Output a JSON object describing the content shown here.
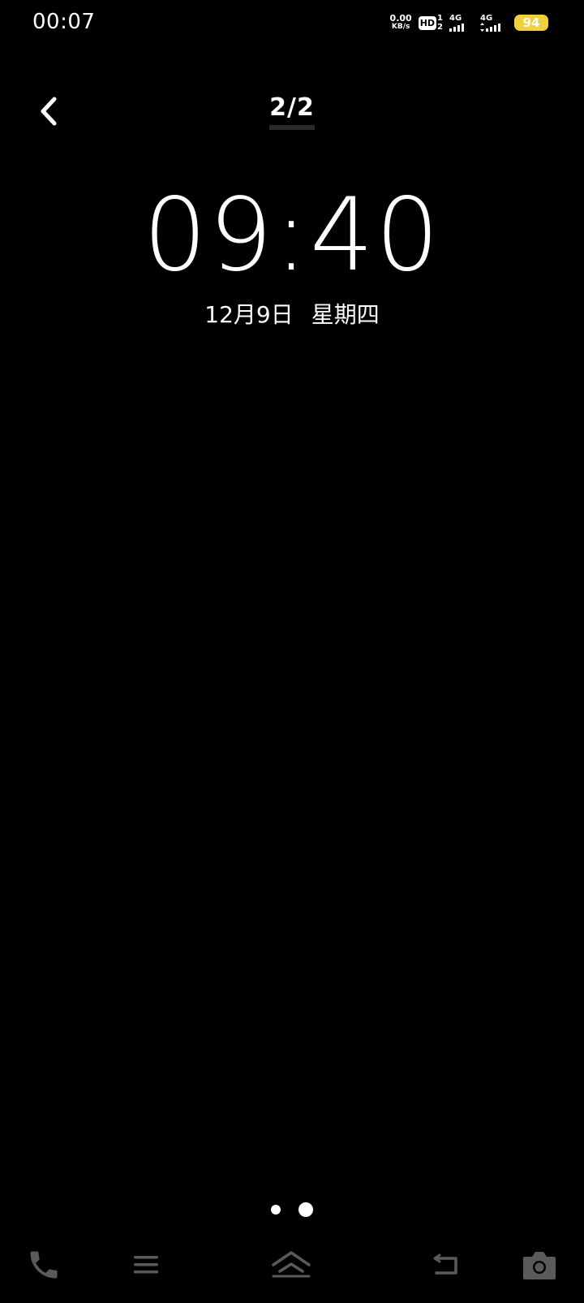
{
  "status_bar": {
    "time": "00:07",
    "net_speed_value": "0.00",
    "net_speed_unit": "KB/s",
    "hd_label": "HD",
    "hd_sim1": "1",
    "hd_sim2": "2",
    "sim1_type": "4G",
    "sim2_type": "4G",
    "battery_level": "94",
    "battery_color": "#f2cf3b"
  },
  "header": {
    "back_icon": "chevron-left-icon",
    "page_indicator": "2/2"
  },
  "preview": {
    "time": "09:40",
    "date": "12月9日",
    "weekday": "星期四"
  },
  "pagination": {
    "total": 2,
    "current": 2
  },
  "bottom_nav": {
    "icons": [
      "phone-icon",
      "menu-icon",
      "home-icon",
      "back-icon",
      "camera-icon"
    ],
    "icon_color": "#5a5a5a"
  }
}
